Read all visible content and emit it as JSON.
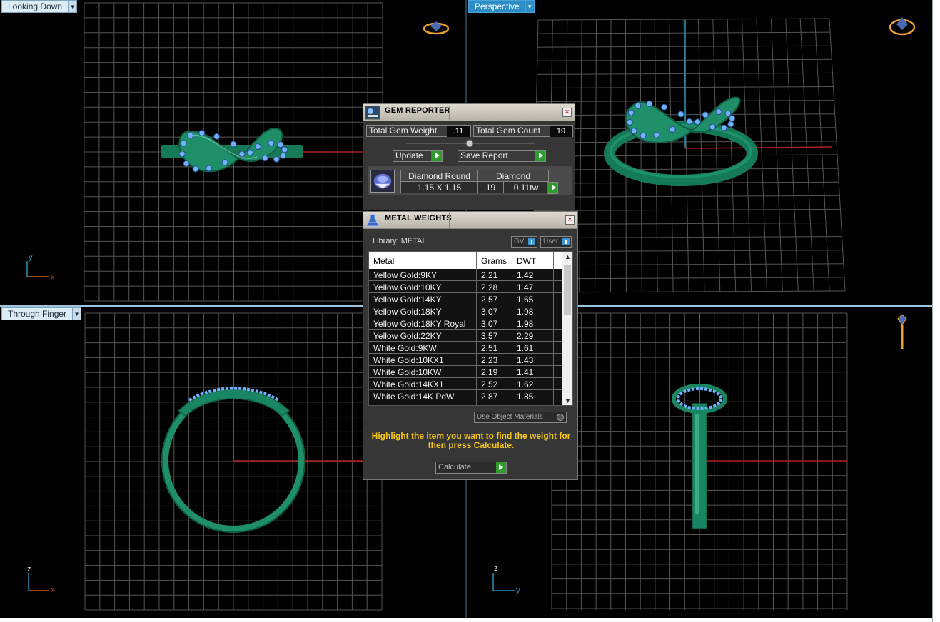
{
  "viewports": {
    "top_left": {
      "label": "Looking Down",
      "axis_h": "x",
      "axis_v": "y"
    },
    "top_right": {
      "label": "Perspective"
    },
    "bottom_left": {
      "label": "Through Finger",
      "axis_h": "x",
      "axis_v": "z"
    },
    "bottom_right": {
      "label": "",
      "axis_h": "y",
      "axis_v": "z"
    }
  },
  "gem_reporter": {
    "title": "GEM REPORTER",
    "total_gem_weight_label": "Total Gem Weight",
    "total_gem_weight": ".11",
    "total_gem_count_label": "Total Gem Count",
    "total_gem_count": "19",
    "update_label": "Update",
    "save_report_label": "Save Report",
    "gem": {
      "shape": "Diamond Round",
      "material": "Diamond",
      "size": "1.15 X 1.15",
      "count": "19",
      "weight": "0.11tw"
    },
    "close_symbol": "×"
  },
  "metal_weights": {
    "title": "METAL WEIGHTS",
    "library_label": "Library: METAL",
    "gv_label": "GV",
    "user_label": "User",
    "columns": [
      "Metal",
      "Grams",
      "DWT"
    ],
    "rows": [
      [
        "Yellow Gold:9KY",
        "2.21",
        "1.42"
      ],
      [
        "Yellow Gold:10KY",
        "2.28",
        "1.47"
      ],
      [
        "Yellow Gold:14KY",
        "2.57",
        "1.65"
      ],
      [
        "Yellow Gold:18KY",
        "3.07",
        "1.98"
      ],
      [
        "Yellow Gold:18KY Royal",
        "3.07",
        "1.98"
      ],
      [
        "Yellow Gold:22KY",
        "3.57",
        "2.29"
      ],
      [
        "White Gold:9KW",
        "2.51",
        "1.61"
      ],
      [
        "White Gold:10KX1",
        "2.23",
        "1.43"
      ],
      [
        "White Gold:10KW",
        "2.19",
        "1.41"
      ],
      [
        "White Gold:14KX1",
        "2.52",
        "1.62"
      ],
      [
        "White Gold:14K PdW",
        "2.87",
        "1.85"
      ]
    ],
    "use_object_materials_label": "Use Object Materials",
    "hint": "Highlight the item you want to find the weight for then press Calculate.",
    "calculate_label": "Calculate",
    "close_symbol": "×"
  },
  "colors": {
    "ring": "#1f8f6a",
    "gems": "#6fb3ff",
    "grid": "#555555",
    "axis_blue": "#2a8fb8",
    "axis_red": "#b02020",
    "hint": "#f5c518"
  }
}
